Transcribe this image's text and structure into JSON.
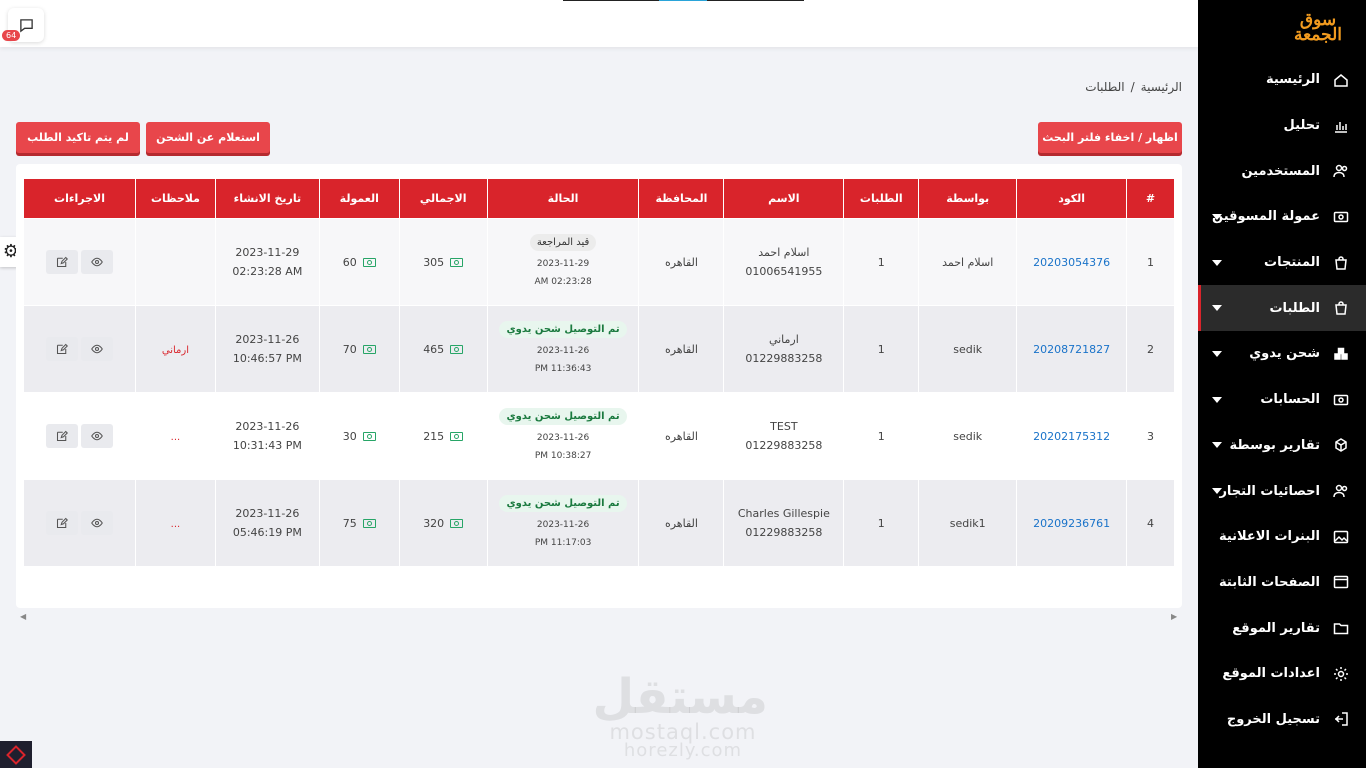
{
  "sidebar": {
    "logo_text": "سوق الجمعة",
    "items": [
      {
        "label": "الرئيسية",
        "icon": "home-icon",
        "has_caret": false,
        "active": false
      },
      {
        "label": "تحليل",
        "icon": "chart-icon",
        "has_caret": false,
        "active": false
      },
      {
        "label": "المستخدمين",
        "icon": "users-icon",
        "has_caret": false,
        "active": false
      },
      {
        "label": "عمولة المسوقين",
        "icon": "money-icon",
        "has_caret": true,
        "active": false
      },
      {
        "label": "المنتجات",
        "icon": "bag-icon",
        "has_caret": true,
        "active": false
      },
      {
        "label": "الطلبات",
        "icon": "bag-icon",
        "has_caret": true,
        "active": true
      },
      {
        "label": "شحن يدوي",
        "icon": "boxes-icon",
        "has_caret": true,
        "active": false
      },
      {
        "label": "الحسابات",
        "icon": "money-icon",
        "has_caret": true,
        "active": false
      },
      {
        "label": "تقارير بوسطة",
        "icon": "bosta-icon",
        "has_caret": true,
        "active": false
      },
      {
        "label": "احصائيات التجار",
        "icon": "users-icon",
        "has_caret": true,
        "active": false
      },
      {
        "label": "البنرات الاعلانية",
        "icon": "image-icon",
        "has_caret": false,
        "active": false
      },
      {
        "label": "الصفحات الثابتة",
        "icon": "window-icon",
        "has_caret": false,
        "active": false
      },
      {
        "label": "تقارير الموقع",
        "icon": "folder-icon",
        "has_caret": false,
        "active": false
      },
      {
        "label": "اعدادات الموقع",
        "icon": "gear-icon",
        "has_caret": false,
        "active": false
      },
      {
        "label": "تسجيل الخروج",
        "icon": "logout-icon",
        "has_caret": false,
        "active": false
      }
    ]
  },
  "header": {
    "notification_count": "64"
  },
  "breadcrumb": {
    "home": "الرئيسية",
    "separator": "/",
    "current": "الطلبات"
  },
  "buttons": {
    "filter_toggle": "اظهار / اخفاء فلتر البحث",
    "shipping_inquiry": "استعلام عن الشحن",
    "unconfirmed": "لم يتم تاكيد الطلب"
  },
  "table": {
    "headers": [
      "#",
      "الكود",
      "بواسطة",
      "الطلبات",
      "الاسم",
      "المحافظة",
      "الحالة",
      "الاجمالي",
      "العمولة",
      "تاريخ الانشاء",
      "ملاحظات",
      "الاجراءات"
    ],
    "rows": [
      {
        "index": "1",
        "code": "20203054376",
        "by": "اسلام احمد",
        "orders": "1",
        "name": "اسلام احمد",
        "phone": "01006541955",
        "governorate": "القاهره",
        "status": "قيد المراجعة",
        "status_type": "pending",
        "status_date": "2023-11-29",
        "status_time": "02:23:28 AM",
        "total": "305",
        "commission": "60",
        "created_date": "2023-11-29",
        "created_time": "02:23:28 AM",
        "notes": ""
      },
      {
        "index": "2",
        "code": "20208721827",
        "by": "sedik",
        "orders": "1",
        "name": "ارماني",
        "phone": "01229883258",
        "governorate": "القاهره",
        "status": "تم التوصيل شحن يدوي",
        "status_type": "delivered",
        "status_date": "2023-11-26",
        "status_time": "11:36:43 PM",
        "total": "465",
        "commission": "70",
        "created_date": "2023-11-26",
        "created_time": "10:46:57 PM",
        "notes": "ارماني"
      },
      {
        "index": "3",
        "code": "20202175312",
        "by": "sedik",
        "orders": "1",
        "name": "TEST",
        "phone": "01229883258",
        "governorate": "القاهره",
        "status": "تم التوصيل شحن يدوي",
        "status_type": "delivered",
        "status_date": "2023-11-26",
        "status_time": "10:38:27 PM",
        "total": "215",
        "commission": "30",
        "created_date": "2023-11-26",
        "created_time": "10:31:43 PM",
        "notes": "..."
      },
      {
        "index": "4",
        "code": "20209236761",
        "by": "sedik1",
        "orders": "1",
        "name": "Charles Gillespie",
        "phone": "01229883258",
        "governorate": "القاهره",
        "status": "تم التوصيل شحن يدوي",
        "status_type": "delivered",
        "status_date": "2023-11-26",
        "status_time": "11:17:03 PM",
        "total": "320",
        "commission": "75",
        "created_date": "2023-11-26",
        "created_time": "05:46:19 PM",
        "notes": "..."
      }
    ]
  },
  "watermark": {
    "arabic": "مستقل",
    "line1": "mostaql.com",
    "line2": "horezly.com"
  },
  "colors": {
    "accent": "#d9242b",
    "button": "#e8464b",
    "sidebar_bg": "#000000",
    "link": "#1a73c9",
    "logo": "#f29b1f"
  }
}
